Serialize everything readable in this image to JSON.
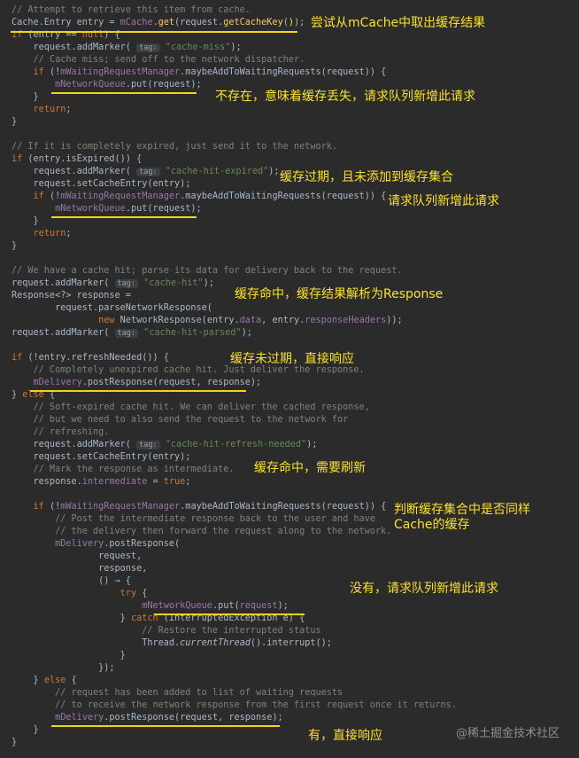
{
  "code": [
    [
      {
        "t": "// Attempt to retrieve this item from cache.",
        "c": "c"
      }
    ],
    [
      {
        "t": "Cache.Entry entry = "
      },
      {
        "t": "mCache",
        "c": "f"
      },
      {
        "t": "."
      },
      {
        "t": "get",
        "c": "m"
      },
      {
        "t": "(request."
      },
      {
        "t": "getCacheKey",
        "c": "m"
      },
      {
        "t": "("
      },
      {
        "t": ")",
        "c": "brk"
      },
      {
        "t": ");"
      }
    ],
    [
      {
        "t": "if",
        "c": "k"
      },
      {
        "t": " (entry == "
      },
      {
        "t": "null",
        "c": "k"
      },
      {
        "t": ") {"
      }
    ],
    [
      {
        "t": "    request.addMarker( "
      },
      {
        "t": "tag:",
        "c": "hint"
      },
      {
        "t": " "
      },
      {
        "t": "\"cache-miss\"",
        "c": "s"
      },
      {
        "t": ");"
      }
    ],
    [
      {
        "t": "    // Cache miss; send off to the network dispatcher.",
        "c": "c"
      }
    ],
    [
      {
        "t": "    "
      },
      {
        "t": "if",
        "c": "k"
      },
      {
        "t": " (!"
      },
      {
        "t": "mWaitingRequestManager",
        "c": "f"
      },
      {
        "t": ".maybeAddToWaitingRequests(request)) {"
      }
    ],
    [
      {
        "t": "        "
      },
      {
        "t": "mNetworkQueue",
        "c": "f"
      },
      {
        "t": ".put(request);"
      }
    ],
    [
      {
        "t": "    }"
      }
    ],
    [
      {
        "t": "    "
      },
      {
        "t": "return",
        "c": "k"
      },
      {
        "t": ";"
      }
    ],
    [
      {
        "t": "}"
      }
    ],
    [],
    [
      {
        "t": "// If it is completely expired, just send it to the network.",
        "c": "c"
      }
    ],
    [
      {
        "t": "if",
        "c": "k"
      },
      {
        "t": " (entry.isExpired()) {"
      }
    ],
    [
      {
        "t": "    request.addMarker( "
      },
      {
        "t": "tag:",
        "c": "hint"
      },
      {
        "t": " "
      },
      {
        "t": "\"cache-hit-expired\"",
        "c": "s"
      },
      {
        "t": ");"
      }
    ],
    [
      {
        "t": "    request.setCacheEntry(entry);"
      }
    ],
    [
      {
        "t": "    "
      },
      {
        "t": "if",
        "c": "k"
      },
      {
        "t": " (!"
      },
      {
        "t": "mWaitingRequestManager",
        "c": "f"
      },
      {
        "t": ".maybeAddToWaitingRequests(request)) {"
      }
    ],
    [
      {
        "t": "        "
      },
      {
        "t": "mNetworkQueue",
        "c": "f"
      },
      {
        "t": ".put(request);"
      }
    ],
    [
      {
        "t": "    }"
      }
    ],
    [
      {
        "t": "    "
      },
      {
        "t": "return",
        "c": "k"
      },
      {
        "t": ";"
      }
    ],
    [
      {
        "t": "}"
      }
    ],
    [],
    [
      {
        "t": "// We have a cache hit; parse its data for delivery back to the request.",
        "c": "c"
      }
    ],
    [
      {
        "t": "request.addMarker( "
      },
      {
        "t": "tag:",
        "c": "hint"
      },
      {
        "t": " "
      },
      {
        "t": "\"cache-hit\"",
        "c": "s"
      },
      {
        "t": ");"
      }
    ],
    [
      {
        "t": "Response<?> response ="
      }
    ],
    [
      {
        "t": "        request.parseNetworkResponse("
      }
    ],
    [
      {
        "t": "                "
      },
      {
        "t": "new",
        "c": "k"
      },
      {
        "t": " NetworkResponse(entry."
      },
      {
        "t": "data",
        "c": "f"
      },
      {
        "t": ", entry."
      },
      {
        "t": "responseHeaders",
        "c": "f"
      },
      {
        "t": "));"
      }
    ],
    [
      {
        "t": "request.addMarker( "
      },
      {
        "t": "tag:",
        "c": "hint"
      },
      {
        "t": " "
      },
      {
        "t": "\"cache-hit-parsed\"",
        "c": "s"
      },
      {
        "t": ");"
      }
    ],
    [],
    [
      {
        "t": "if",
        "c": "k"
      },
      {
        "t": " (!entry.refreshNeeded()) {"
      }
    ],
    [
      {
        "t": "    // Completely unexpired cache hit. Just deliver the response.",
        "c": "c"
      }
    ],
    [
      {
        "t": "    "
      },
      {
        "t": "mDelivery",
        "c": "f"
      },
      {
        "t": ".postResponse(request, response);"
      }
    ],
    [
      {
        "t": "} "
      },
      {
        "t": "else",
        "c": "k"
      },
      {
        "t": " {"
      }
    ],
    [
      {
        "t": "    // Soft-expired cache hit. We can deliver the cached response,",
        "c": "c"
      }
    ],
    [
      {
        "t": "    // but we need to also send the request to the network for",
        "c": "c"
      }
    ],
    [
      {
        "t": "    // refreshing.",
        "c": "c"
      }
    ],
    [
      {
        "t": "    request.addMarker( "
      },
      {
        "t": "tag:",
        "c": "hint"
      },
      {
        "t": " "
      },
      {
        "t": "\"cache-hit-refresh-needed\"",
        "c": "s"
      },
      {
        "t": ");"
      }
    ],
    [
      {
        "t": "    request.setCacheEntry(entry);"
      }
    ],
    [
      {
        "t": "    // Mark the response as intermediate.",
        "c": "c"
      }
    ],
    [
      {
        "t": "    response."
      },
      {
        "t": "intermediate",
        "c": "f"
      },
      {
        "t": " = "
      },
      {
        "t": "true",
        "c": "k"
      },
      {
        "t": ";"
      }
    ],
    [],
    [
      {
        "t": "    "
      },
      {
        "t": "if",
        "c": "k"
      },
      {
        "t": " (!"
      },
      {
        "t": "mWaitingRequestManager",
        "c": "f"
      },
      {
        "t": ".maybeAddToWaitingRequests(request)) {"
      }
    ],
    [
      {
        "t": "        // Post the intermediate response back to the user and have",
        "c": "c"
      }
    ],
    [
      {
        "t": "        // the delivery then forward the request along to the network.",
        "c": "c"
      }
    ],
    [
      {
        "t": "        "
      },
      {
        "t": "mDelivery",
        "c": "f"
      },
      {
        "t": ".postResponse("
      }
    ],
    [
      {
        "t": "                request,"
      }
    ],
    [
      {
        "t": "                response,"
      }
    ],
    [
      {
        "t": "                () → {"
      }
    ],
    [
      {
        "t": "                    "
      },
      {
        "t": "try",
        "c": "k"
      },
      {
        "t": " {"
      }
    ],
    [
      {
        "t": "                        "
      },
      {
        "t": "mNetworkQueue",
        "c": "f"
      },
      {
        "t": ".put("
      },
      {
        "t": "request",
        "c": "f"
      },
      {
        "t": ");"
      }
    ],
    [
      {
        "t": "                    } "
      },
      {
        "t": "catch",
        "c": "k"
      },
      {
        "t": " (InterruptedException e) {"
      }
    ],
    [
      {
        "t": "                        // Restore the interrupted status",
        "c": "c"
      }
    ],
    [
      {
        "t": "                        Thread."
      },
      {
        "t": "currentThread",
        "c": "i"
      },
      {
        "t": "().interrupt();"
      }
    ],
    [
      {
        "t": "                    }"
      }
    ],
    [
      {
        "t": "                });"
      }
    ],
    [
      {
        "t": "    } "
      },
      {
        "t": "else",
        "c": "k"
      },
      {
        "t": " {"
      }
    ],
    [
      {
        "t": "        // request has been added to list of waiting requests",
        "c": "c"
      }
    ],
    [
      {
        "t": "        // to receive the network response from the first request once it returns.",
        "c": "c"
      }
    ],
    [
      {
        "t": "        "
      },
      {
        "t": "mDelivery",
        "c": "f"
      },
      {
        "t": ".postResponse(request, response);"
      }
    ],
    [
      {
        "t": "    }"
      }
    ],
    [
      {
        "t": "}"
      }
    ]
  ],
  "annotations": {
    "a1": "尝试从mCache中取出缓存结果",
    "a2": "不存在，意味着缓存丢失，请求队列新增此请求",
    "a3": "缓存过期，且未添加到缓存集合",
    "a4": "请求队列新增此请求",
    "a5": "缓存命中，缓存结果解析为Response",
    "a6": "缓存未过期，直接响应",
    "a7": "缓存命中，需要刷新",
    "a8": "判断缓存集合中是否同样\nCache的缓存",
    "a9": "没有，请求队列新增此请求",
    "a10": "有，直接响应"
  },
  "watermark": "@稀土掘金技术社区",
  "colors": {
    "background": "#2b2b2b",
    "text": "#a9b7c6",
    "comment": "#808080",
    "keyword": "#cc7832",
    "field": "#9876aa",
    "string": "#6a8759",
    "method": "#ffc66d",
    "annotation": "#fbe12e",
    "underline": "#f5d415"
  }
}
